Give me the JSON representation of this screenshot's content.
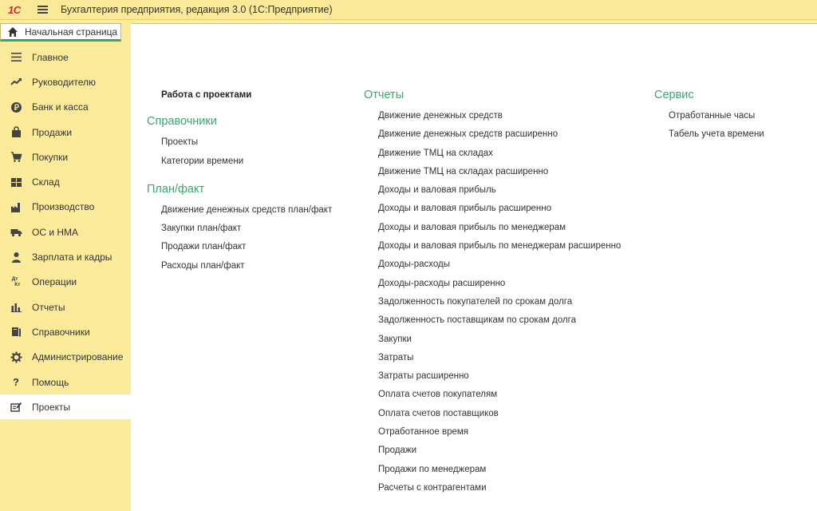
{
  "titlebar": {
    "logo": "1С",
    "title": "Бухгалтерия предприятия, редакция 3.0  (1С:Предприятие)"
  },
  "home_tab": {
    "label": "Начальная страница"
  },
  "sidebar": {
    "items": [
      {
        "label": "Главное",
        "icon": "menu-lines-icon"
      },
      {
        "label": "Руководителю",
        "icon": "trend-up-icon"
      },
      {
        "label": "Банк и касса",
        "icon": "ruble-coin-icon"
      },
      {
        "label": "Продажи",
        "icon": "shopping-bag-icon"
      },
      {
        "label": "Покупки",
        "icon": "cart-icon"
      },
      {
        "label": "Склад",
        "icon": "warehouse-grid-icon"
      },
      {
        "label": "Производство",
        "icon": "factory-icon"
      },
      {
        "label": "ОС и НМА",
        "icon": "truck-icon"
      },
      {
        "label": "Зарплата и кадры",
        "icon": "person-icon"
      },
      {
        "label": "Операции",
        "icon": "dt-kt-icon",
        "glyph": "Дт Кт"
      },
      {
        "label": "Отчеты",
        "icon": "bar-chart-icon"
      },
      {
        "label": "Справочники",
        "icon": "books-icon"
      },
      {
        "label": "Администрирование",
        "icon": "gear-icon"
      },
      {
        "label": "Помощь",
        "icon": "question-icon",
        "glyph": "?"
      },
      {
        "label": "Проекты",
        "icon": "projects-icon"
      }
    ],
    "active_index": 14
  },
  "main": {
    "col1": {
      "top_link": "Работа с проектами",
      "sections": [
        {
          "heading": "Справочники",
          "links": [
            "Проекты",
            "Категории времени"
          ]
        },
        {
          "heading": "План/факт",
          "links": [
            "Движение денежных средств план/факт",
            "Закупки план/факт",
            "Продажи план/факт",
            "Расходы план/факт"
          ]
        }
      ]
    },
    "col2": {
      "heading": "Отчеты",
      "links": [
        "Движение денежных средств",
        "Движение денежных средств расширенно",
        "Движение ТМЦ на складах",
        "Движение ТМЦ на складах расширенно",
        "Доходы и валовая прибыль",
        "Доходы и валовая прибыль расширенно",
        "Доходы и валовая прибыль по менеджерам",
        "Доходы и валовая прибыль по менеджерам расширенно",
        "Доходы-расходы",
        "Доходы-расходы расширенно",
        "Задолженность покупателей по срокам долга",
        "Задолженность поставщикам по срокам долга",
        "Закупки",
        "Затраты",
        "Затраты расширенно",
        "Оплата счетов покупателям",
        "Оплата счетов поставщиков",
        "Отработанное время",
        "Продажи",
        "Продажи по менеджерам",
        "Расчеты с контрагентами"
      ]
    },
    "col3": {
      "heading": "Сервис",
      "links": [
        "Отработанные часы",
        "Табель учета времени"
      ]
    }
  },
  "colors": {
    "accent_green": "#3aa66b",
    "bg_yellow": "#fbeb9b",
    "logo_red": "#d3262a"
  }
}
